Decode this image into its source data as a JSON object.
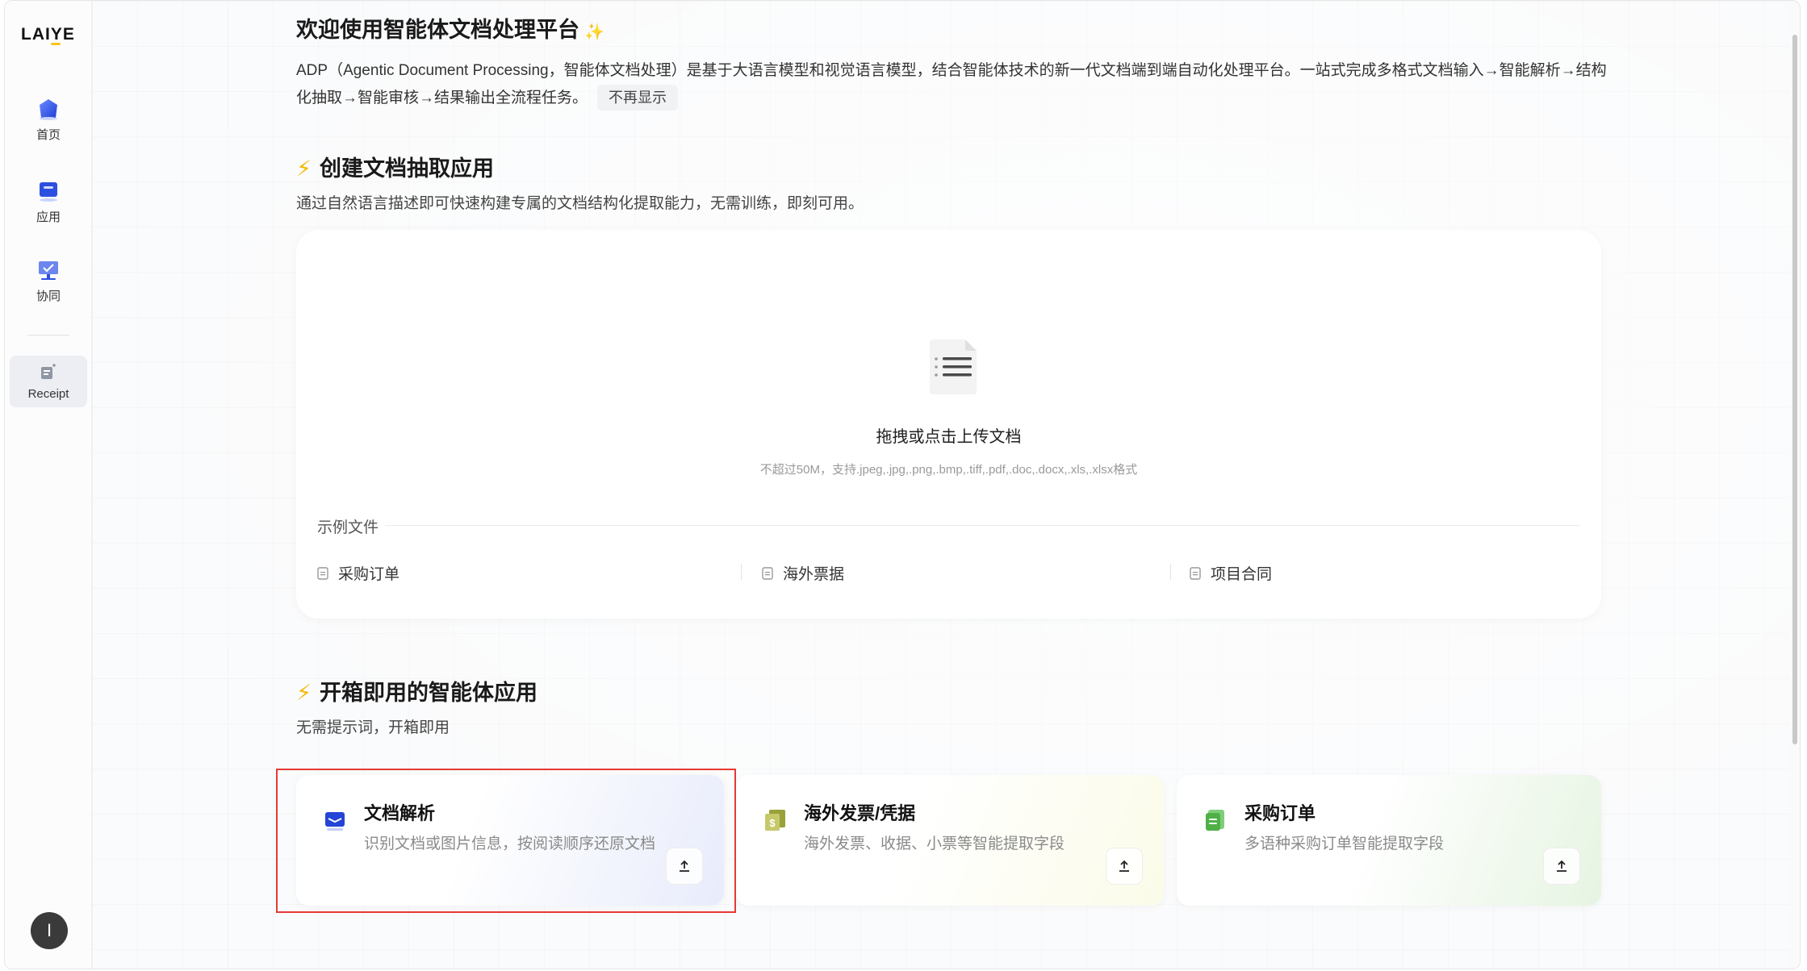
{
  "sidebar": {
    "logo": "LAIYE",
    "items": [
      {
        "label": "首页",
        "icon": "home-icon"
      },
      {
        "label": "应用",
        "icon": "apps-icon"
      },
      {
        "label": "协同",
        "icon": "collaboration-icon"
      },
      {
        "label": "Receipt",
        "icon": "receipt-icon"
      }
    ],
    "active_item": "Receipt",
    "avatar_initial": "I"
  },
  "welcome": {
    "title": "欢迎使用智能体文档处理平台",
    "sparkle": "✨",
    "intro": "ADP（Agentic Document Processing，智能体文档处理）是基于大语言模型和视觉语言模型，结合智能体技术的新一代文档端到端自动化处理平台。一站式完成多格式文档输入→智能解析→结构化抽取→智能审核→结果输出全流程任务。",
    "dismiss_label": "不再显示"
  },
  "create_section": {
    "title": "创建文档抽取应用",
    "desc": "通过自然语言描述即可快速构建专属的文档结构化提取能力，无需训练，即刻可用。",
    "upload": {
      "title": "拖拽或点击上传文档",
      "hint": "不超过50M，支持.jpeg,.jpg,.png,.bmp,.tiff,.pdf,.doc,.docx,.xls,.xlsx格式",
      "icon": "document-icon"
    },
    "examples_label": "示例文件",
    "examples": [
      "采购订单",
      "海外票据",
      "项目合同"
    ]
  },
  "apps_section": {
    "title": "开箱即用的智能体应用",
    "desc": "无需提示词，开箱即用",
    "cards": [
      {
        "title": "文档解析",
        "desc": "识别文档或图片信息，按阅读顺序还原文档",
        "icon": "document-parse-icon"
      },
      {
        "title": "海外发票/凭据",
        "desc": "海外发票、收据、小票等智能提取字段",
        "icon": "invoice-icon"
      },
      {
        "title": "采购订单",
        "desc": "多语种采购订单智能提取字段",
        "icon": "purchase-order-icon"
      }
    ]
  },
  "colors": {
    "accent": "#3b5bdb",
    "bolt": "#f5b800",
    "highlight": "#e53935"
  }
}
